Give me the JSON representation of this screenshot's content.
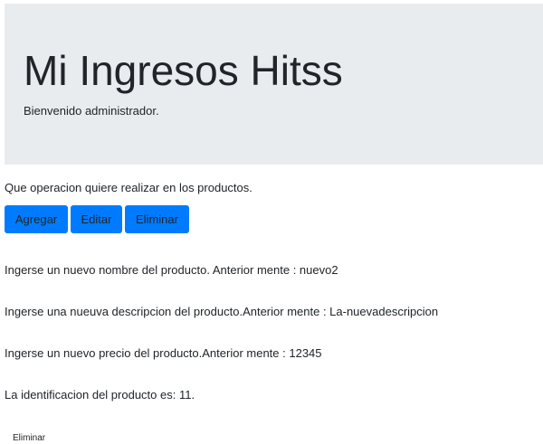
{
  "header": {
    "title": "Mi Ingresos Hitss",
    "subtitle": "Bienvenido administrador."
  },
  "operations": {
    "prompt": "Que operacion quiere realizar en los productos.",
    "buttons": {
      "add_label": "Agregar",
      "edit_label": "Editar",
      "delete_label": "Eliminar"
    }
  },
  "product_info": {
    "name_line": "Ingerse un nuevo nombre del producto. Anterior mente : nuevo2",
    "description_line": "Ingerse una nueuva descripcion del producto.Anterior mente : La-nuevadescripcion",
    "price_line": "Ingerse un nuevo precio del producto.Anterior mente : 12345",
    "id_line": "La identificacion del producto es: 11."
  },
  "footer": {
    "delete_label": "Eliminar"
  },
  "colors": {
    "jumbotron_bg": "#e9ecef",
    "primary": "#007bff",
    "text": "#212529"
  }
}
